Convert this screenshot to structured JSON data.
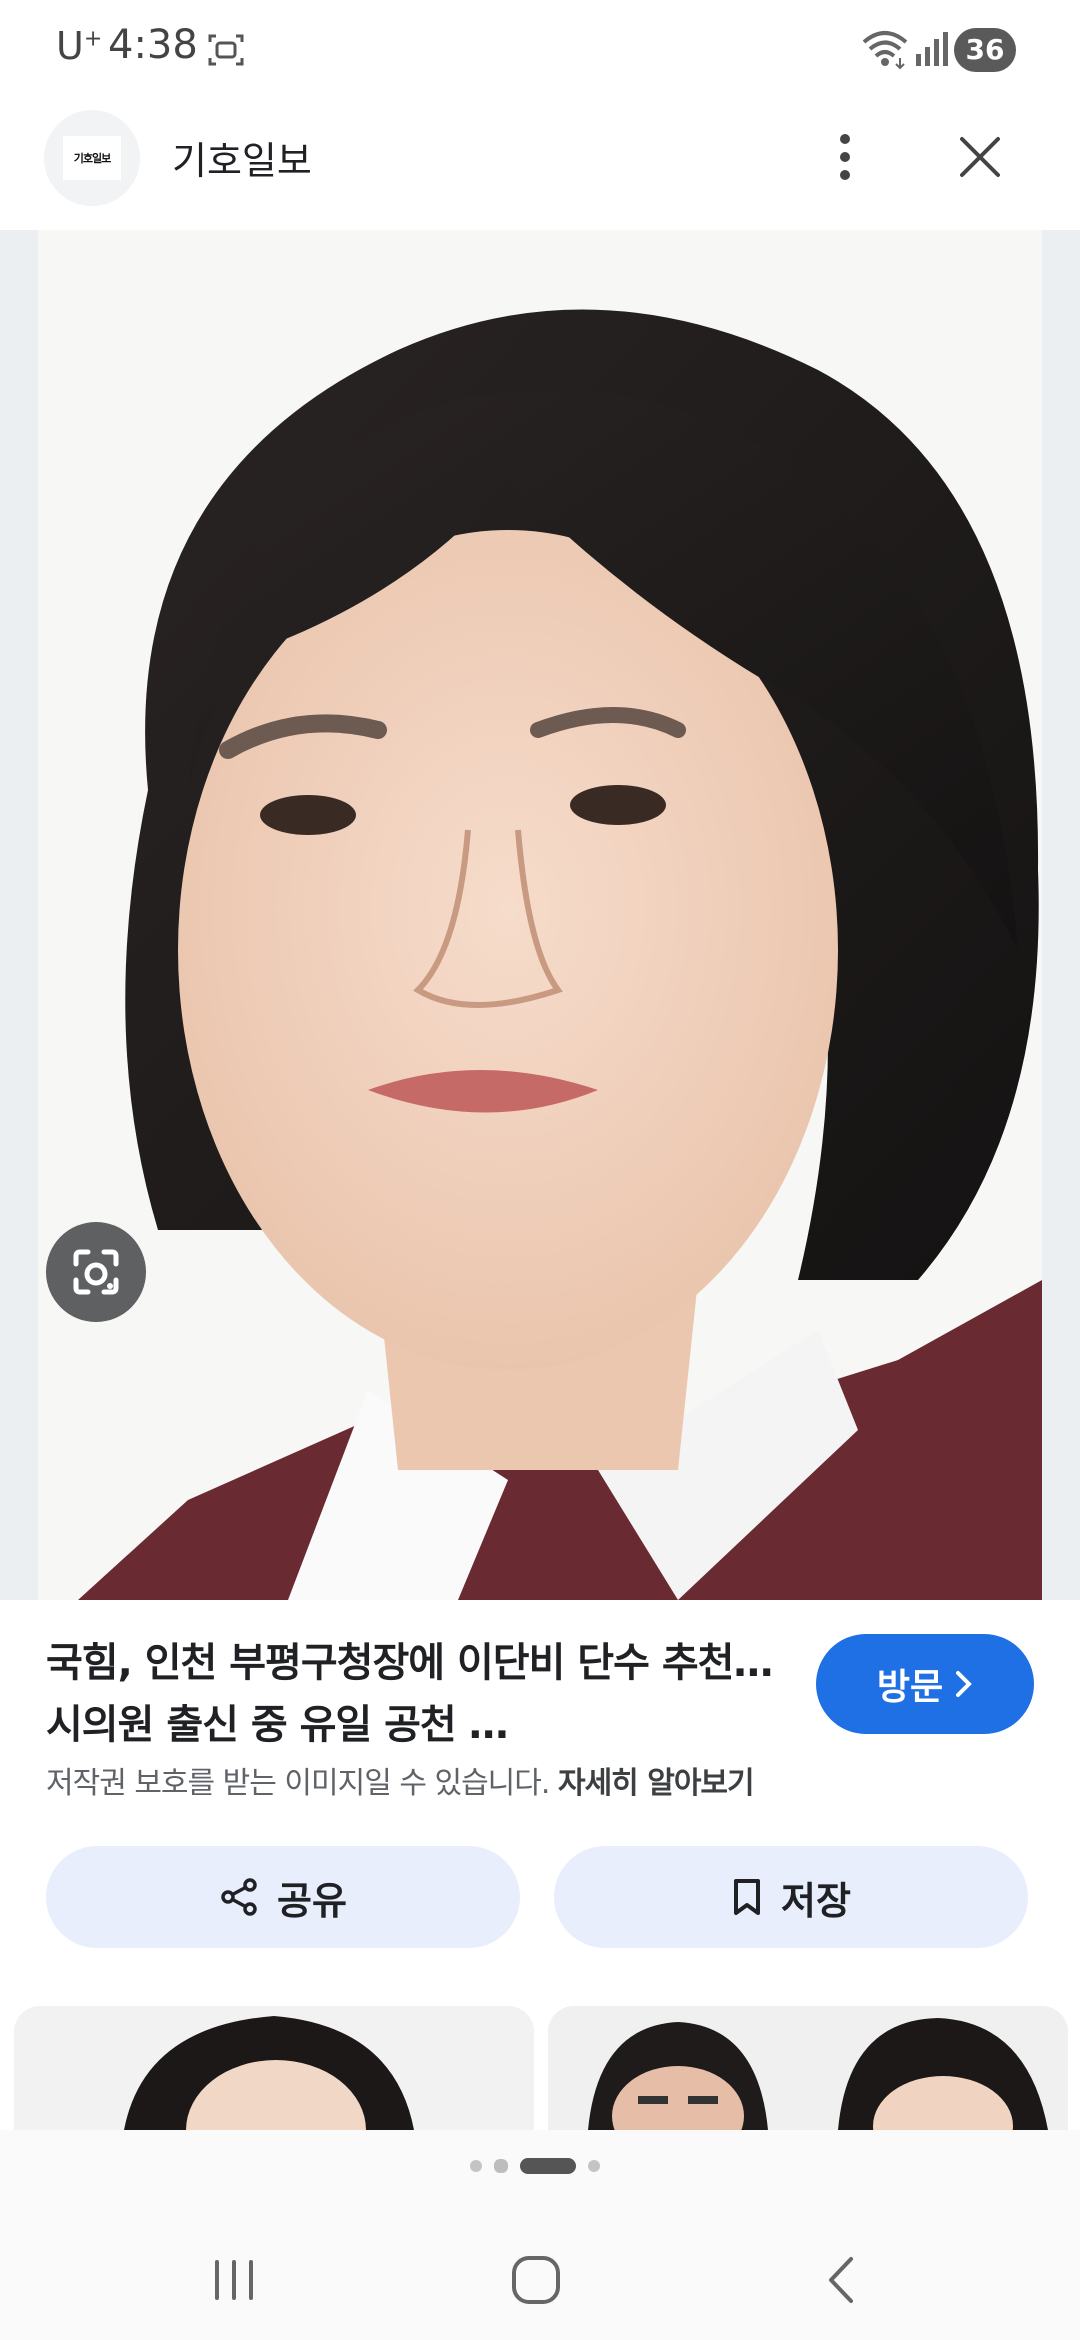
{
  "status_bar": {
    "carrier": "U",
    "carrier_sup": "+",
    "time": "4:38",
    "battery": "36"
  },
  "header": {
    "logo_text": "기호일보",
    "site_name": "기호일보"
  },
  "result": {
    "title": "국힘, 인천 부평구청장에 이단비 단수 추천…시의원 출신 중 유일 공천 …",
    "visit_label": "방문",
    "copyright_text": "저작권 보호를 받는 이미지일 수 있습니다.",
    "learn_more_label": "자세히 알아보기"
  },
  "actions": {
    "share_label": "공유",
    "save_label": "저장"
  },
  "pager": {
    "page_count": 4,
    "active_index": 2
  },
  "icons": {
    "screen_icon": "screenshot-icon",
    "wifi_icon": "wifi-icon",
    "signal_icon": "signal-icon",
    "more_icon": "more-vertical-icon",
    "close_icon": "close-icon",
    "lens_icon": "google-lens-icon",
    "share_icon": "share-icon",
    "save_icon": "bookmark-icon",
    "visit_icon": "chevron-right-icon",
    "recent_icon": "recent-apps-icon",
    "home_icon": "home-icon",
    "back_icon": "back-icon"
  },
  "colors": {
    "accent": "#1f6fe5",
    "action_bg": "#e8eefb",
    "jacket": "#6a2a32",
    "hair": "#1b1818"
  }
}
